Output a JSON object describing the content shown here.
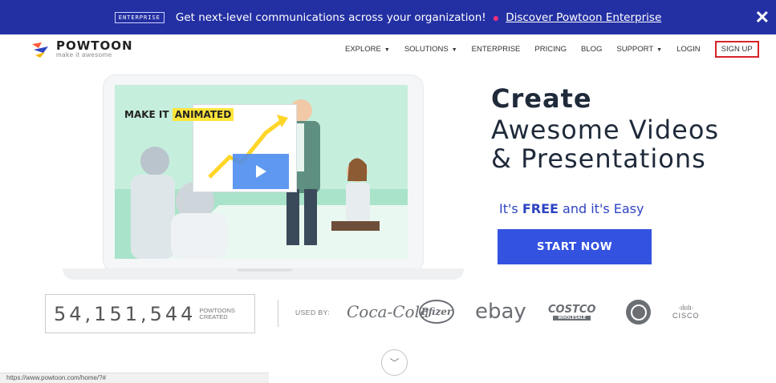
{
  "banner": {
    "badge": "ENTERPRISE",
    "message": "Get next-level communications across your organization!",
    "link": "Discover Powtoon Enterprise",
    "close": "✕"
  },
  "logo": {
    "name": "POWTOON",
    "tagline": "make it awesome"
  },
  "nav": {
    "items": [
      "EXPLORE",
      "SOLUTIONS",
      "ENTERPRISE",
      "PRICING",
      "BLOG",
      "SUPPORT",
      "LOGIN"
    ],
    "signup": "SIGN UP"
  },
  "hero": {
    "make_it": "MAKE IT",
    "animated": "ANIMATED",
    "title": "Create",
    "subtitle": "Awesome Videos\n& Presentations",
    "free_prefix": "It's",
    "free_bold": "FREE",
    "free_suffix": "and it's Easy",
    "cta": "START NOW"
  },
  "stats": {
    "count": "54,151,544",
    "label_line1": "POWTOONS",
    "label_line2": "CREATED",
    "used_by": "USED BY:"
  },
  "brands": {
    "coke": "Coca-Cola",
    "pfizer": "Pfizer",
    "ebay": "ebay",
    "costco": "COSTCO",
    "costco_sub": "WHOLESALE",
    "cisco_bars": "·ılıılı·",
    "cisco": "CISCO"
  },
  "status_url": "https://www.powtoon.com/home/?#",
  "colors": {
    "banner": "#2330a3",
    "cta": "#3352e0",
    "accent_text": "#2e44c2",
    "signup_border": "#d8232a",
    "hero_bg": "#c6eedd"
  }
}
